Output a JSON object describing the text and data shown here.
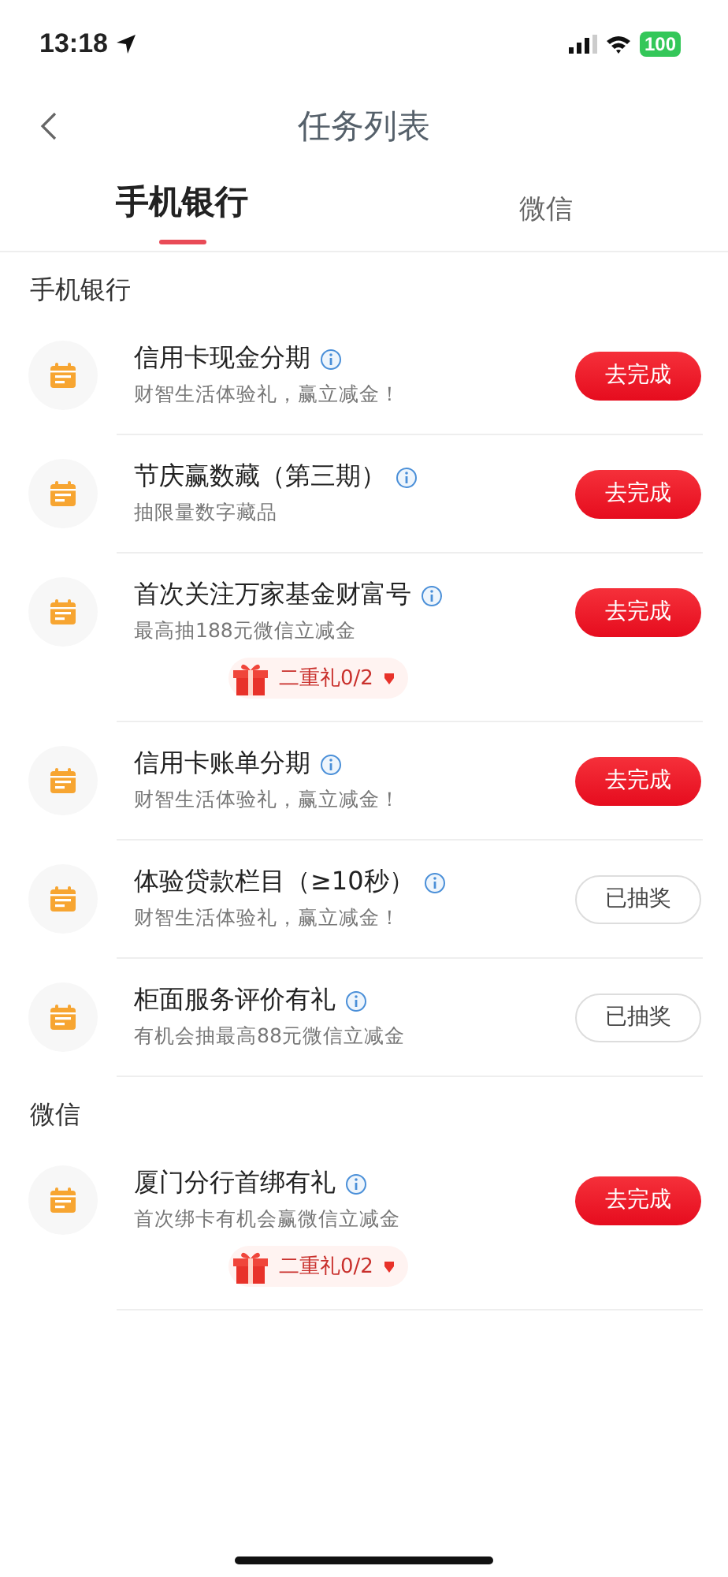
{
  "status_bar": {
    "time": "13:18",
    "battery": "100"
  },
  "header": {
    "title": "任务列表"
  },
  "tabs": [
    {
      "label": "手机银行",
      "selected": true
    },
    {
      "label": "微信",
      "selected": false
    }
  ],
  "sections": [
    {
      "title": "手机银行",
      "tasks": [
        {
          "title": "信用卡现金分期",
          "subtitle": "财智生活体验礼，赢立减金！",
          "button": "去完成",
          "done": false
        },
        {
          "title": "节庆赢数藏（第三期）",
          "subtitle": "抽限量数字藏品",
          "button": "去完成",
          "done": false
        },
        {
          "title": "首次关注万家基金财富号",
          "subtitle": "最高抽188元微信立减金",
          "button": "去完成",
          "done": false,
          "bonus": "二重礼0/2"
        },
        {
          "title": "信用卡账单分期",
          "subtitle": "财智生活体验礼，赢立减金！",
          "button": "去完成",
          "done": false
        },
        {
          "title": "体验贷款栏目（≥10秒）",
          "subtitle": "财智生活体验礼，赢立减金！",
          "button": "已抽奖",
          "done": true
        },
        {
          "title": "柜面服务评价有礼",
          "subtitle": "有机会抽最高88元微信立减金",
          "button": "已抽奖",
          "done": true
        }
      ]
    },
    {
      "title": "微信",
      "tasks": [
        {
          "title": "厦门分行首绑有礼",
          "subtitle": "首次绑卡有机会赢微信立减金",
          "button": "去完成",
          "done": false,
          "bonus": "二重礼0/2"
        }
      ]
    }
  ]
}
